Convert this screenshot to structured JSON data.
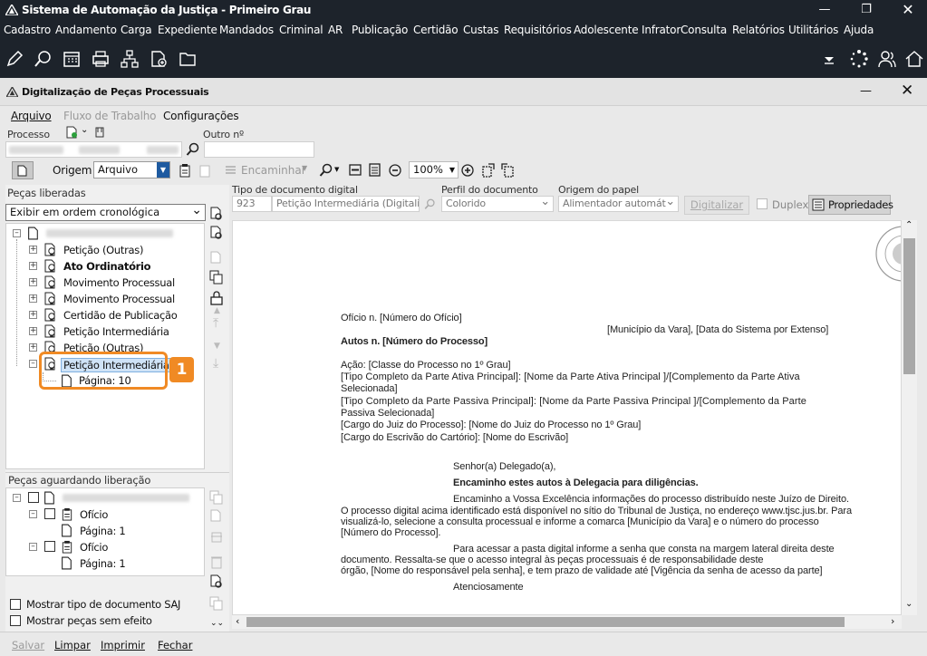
{
  "window": {
    "title": "Sistema de Automação da Justiça - Primeiro Grau"
  },
  "menu": [
    "Cadastro",
    "Andamento",
    "Carga",
    "Expediente",
    "Mandados",
    "Criminal",
    "AR",
    "Publicação",
    "Certidão",
    "Custas",
    "Requisitórios",
    "Adolescente Infrator",
    "Consulta",
    "Relatórios",
    "Utilitários",
    "Ajuda"
  ],
  "subwindow": {
    "title": "Digitalização de Peças Processuais"
  },
  "appmenu": {
    "arquivo": "Arquivo",
    "fluxo": "Fluxo de Trabalho",
    "config": "Configurações"
  },
  "fields": {
    "processo_label": "Processo",
    "outro_label": "Outro nº",
    "origem_label": "Origem",
    "origem_value": "Arquivo",
    "encaminhar": "Encaminhar",
    "zoom": "100%"
  },
  "docfields": {
    "tipo_label": "Tipo de documento digital",
    "tipo_code": "923",
    "tipo_name": "Petição Intermediária (Digitaliz",
    "perfil_label": "Perfil do documento",
    "perfil_value": "Colorido",
    "origem_papel_label": "Origem do papel",
    "origem_papel_value": "Alimentador automát",
    "digitalizar": "Digitalizar",
    "duplex": "Duplex",
    "propriedades": "Propriedades"
  },
  "left": {
    "liberadas_title": "Peças liberadas",
    "order_value": "Exibir em ordem cronológica",
    "tree": [
      {
        "label": "Petição (Outras)",
        "bold": false
      },
      {
        "label": "Ato Ordinatório",
        "bold": true
      },
      {
        "label": "Movimento Processual",
        "bold": false
      },
      {
        "label": "Movimento Processual",
        "bold": false
      },
      {
        "label": "Certidão de Publicação",
        "bold": false
      },
      {
        "label": "Petição Intermediária",
        "bold": false
      },
      {
        "label": "Petição (Outras)",
        "bold": false
      },
      {
        "label": "Petição Intermediária",
        "bold": false,
        "selected": true
      }
    ],
    "selected_page": "Página: 10",
    "aguardando_title": "Peças aguardando liberação",
    "aguardando": [
      {
        "label": "Ofício",
        "page": "Página: 1"
      },
      {
        "label": "Ofício",
        "page": "Página: 1"
      }
    ],
    "chk1": "Mostrar tipo de documento SAJ",
    "chk2": "Mostrar peças sem efeito"
  },
  "callout": {
    "number": "1",
    "color": "#f08a24"
  },
  "document": {
    "l1": "Ofício n. [Número do Ofício]",
    "l2": "[Município da Vara], [Data do Sistema por Extenso]",
    "l3": "Autos n. [Número do Processo]",
    "l4": "Ação: [Classe do Processo no 1º Grau]",
    "l5a": "[Tipo Completo da Parte Ativa Principal]: [Nome da Parte Ativa Principal ]/[Complemento da Parte Ativa",
    "l5b": "Selecionada]",
    "l6a": "[Tipo Completo da Parte Passiva Principal]: [Nome da Parte Passiva Principal ]/[Complemento da Parte",
    "l6b": "Passiva Selecionada]",
    "l7": "[Cargo do Juiz do Processo]: [Nome do Juiz do Processo no 1º Grau]",
    "l8": "[Cargo do Escrivão do Cartório]: [Nome do Escrivão]",
    "l9": "Senhor(a) Delegado(a),",
    "l10": "Encaminho estes autos à Delegacia para diligências.",
    "l11": "Encaminho a Vossa Excelência informações do processo distribuído neste Juízo de Direito.",
    "l12": "O processo digital acima identificado está disponível no sítio do Tribunal de Justiça, no endereço www.tjsc.jus.br. Para",
    "l13": "visualizá-lo, selecione a consulta processual e informe a comarca   [Município da Vara] e o número do processo",
    "l14": "[Número do Processo].",
    "l15": "Para acessar a pasta digital informe a senha que consta na margem lateral direita deste",
    "l16": "documento. Ressalta-se que o acesso integral às peças processuais é de responsabilidade deste",
    "l17": "órgão, [Nome do responsável pela senha], e tem prazo de validade até [Vigência da senha de acesso da parte]",
    "l18": "Atenciosamente"
  },
  "status": {
    "salvar": "Salvar",
    "limpar": "Limpar",
    "imprimir": "Imprimir",
    "fechar": "Fechar"
  }
}
